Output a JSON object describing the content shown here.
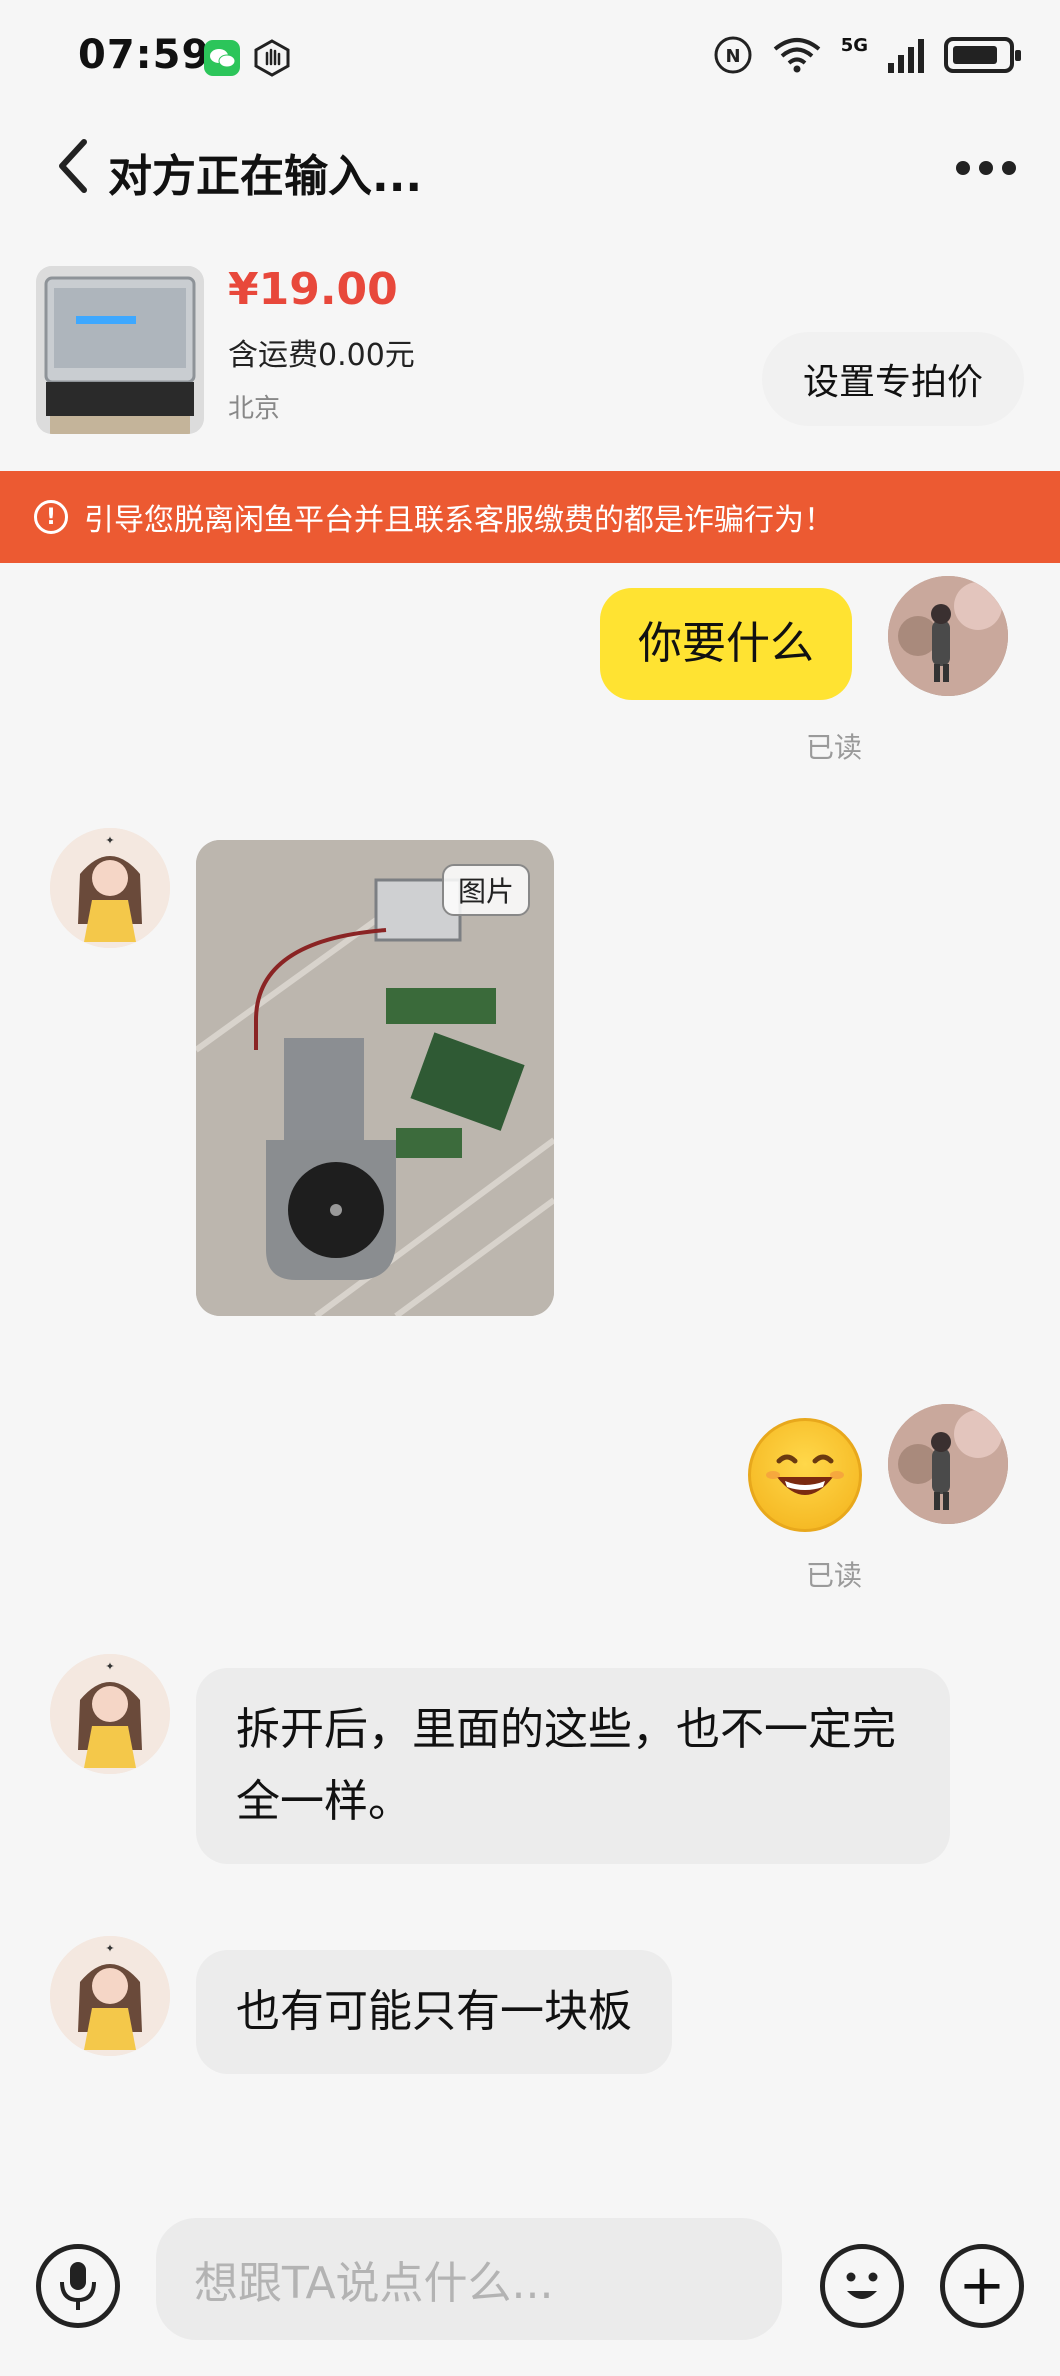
{
  "status_bar": {
    "time": "07:59",
    "network": "5G",
    "icons": [
      "wechat-icon",
      "hand-icon",
      "nfc-icon",
      "wifi-icon",
      "signal-icon",
      "battery-icon"
    ]
  },
  "header": {
    "title": "对方正在输入..."
  },
  "product": {
    "price": "¥19.00",
    "shipping": "含运费0.00元",
    "location": "北京",
    "special_price_button": "设置专拍价"
  },
  "warning": {
    "text": "引导您脱离闲鱼平台并且联系客服缴费的都是诈骗行为！"
  },
  "messages": [
    {
      "side": "self",
      "type": "text",
      "text": "你要什么",
      "status": "已读"
    },
    {
      "side": "other",
      "type": "image",
      "tag": "图片"
    },
    {
      "side": "self",
      "type": "emoji",
      "status": "已读"
    },
    {
      "side": "other",
      "type": "text",
      "text": "拆开后，里面的这些，也不一定完全一样。"
    },
    {
      "side": "other",
      "type": "text",
      "text": "也有可能只有一块板"
    }
  ],
  "input": {
    "placeholder": "想跟TA说点什么..."
  },
  "colors": {
    "warning_bg": "#ec5a32",
    "self_bubble": "#ffe332",
    "other_bubble": "#ececec",
    "price": "#e8483b"
  }
}
